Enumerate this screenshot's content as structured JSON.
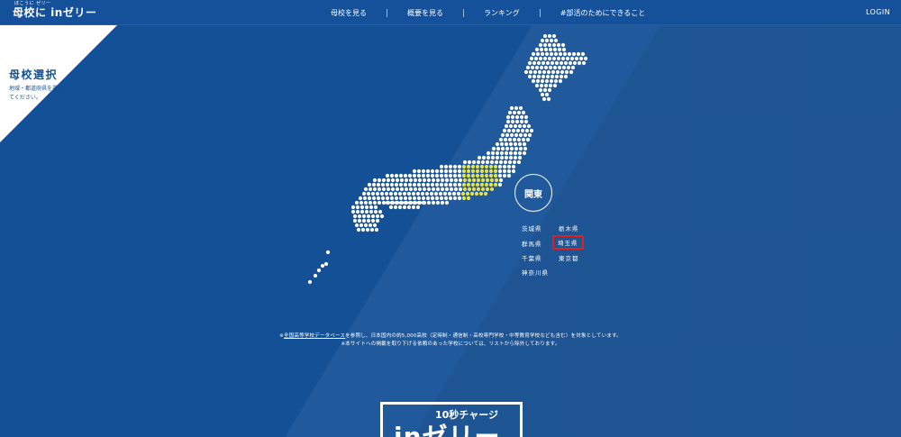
{
  "header": {
    "logo_text": "母校に inゼリー",
    "logo_ruby": "ぼこうに ゼリー",
    "nav": [
      {
        "label": "母校を見る"
      },
      {
        "label": "概要を見る"
      },
      {
        "label": "ランキング"
      },
      {
        "label": "#部活のためにできること"
      }
    ],
    "login_label": "LOGIN"
  },
  "panel": {
    "title": "母校選択",
    "description": "地域・都道府県を選択してください。"
  },
  "region": {
    "name": "関東",
    "prefectures": [
      {
        "label": "茨城県",
        "selected": false
      },
      {
        "label": "栃木県",
        "selected": false
      },
      {
        "label": "群馬県",
        "selected": false
      },
      {
        "label": "埼玉県",
        "selected": true
      },
      {
        "label": "千葉県",
        "selected": false
      },
      {
        "label": "東京都",
        "selected": false
      },
      {
        "label": "神奈川県",
        "selected": false
      }
    ]
  },
  "notes": {
    "line1_link": "全国高等学校データベース",
    "line1_prefix": "※",
    "line1_rest": "を参照し、日本国内の約5,000高校（定時制・通信制・高校専門学校・中等教育学校なども含む）を対象としています。",
    "line2": "※本サイトへの掲載を取り下げる依頼のあった学校については、リストから除外しております。"
  },
  "promo": {
    "sub": "10秒チャージ",
    "main": "inゼリー"
  },
  "colors": {
    "background": "#135096",
    "highlight": "#e6e14a",
    "selected_border": "#e0201c",
    "dots": "#ffffff"
  }
}
